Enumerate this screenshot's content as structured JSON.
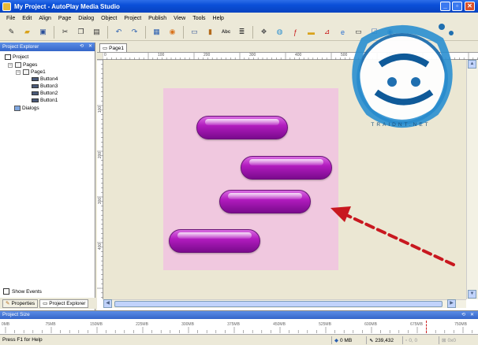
{
  "window": {
    "title": "My Project - AutoPlay Media Studio"
  },
  "menu": [
    "File",
    "Edit",
    "Align",
    "Page",
    "Dialog",
    "Object",
    "Project",
    "Publish",
    "View",
    "Tools",
    "Help"
  ],
  "toolbar": {
    "abc_label": "Abc"
  },
  "explorer": {
    "title": "Project Explorer",
    "tree": {
      "project": "Project",
      "pages": "Pages",
      "page1": "Page1",
      "buttons": [
        "Button4",
        "Button3",
        "Button2",
        "Button1"
      ],
      "dialogs": "Dialogs"
    },
    "show_events": "Show Events",
    "tab_properties": "Properties",
    "tab_explorer": "Project Explorer"
  },
  "editor": {
    "page_tab": "Page1",
    "ruler_top": [
      "0",
      "100",
      "200",
      "300",
      "400",
      "500",
      "600"
    ],
    "ruler_left": [
      "100",
      "200",
      "300",
      "400"
    ]
  },
  "size_panel": {
    "title": "Project Size",
    "ticks": [
      "0MB",
      "75MB",
      "150MB",
      "225MB",
      "300MB",
      "375MB",
      "450MB",
      "525MB",
      "600MB",
      "675MB",
      "750MB"
    ]
  },
  "status": {
    "help": "Press F1 for Help",
    "size": "0 MB",
    "coords": "239,432",
    "pos": "0, 0",
    "dims": "0x0"
  },
  "watermark": {
    "latin": "TRAIDNT.NET"
  },
  "colors": {
    "title_blue": "#0a4fd8",
    "page_pink": "#f0c8df",
    "button_purple": "#b21cbf",
    "arrow_red": "#c8181f"
  }
}
